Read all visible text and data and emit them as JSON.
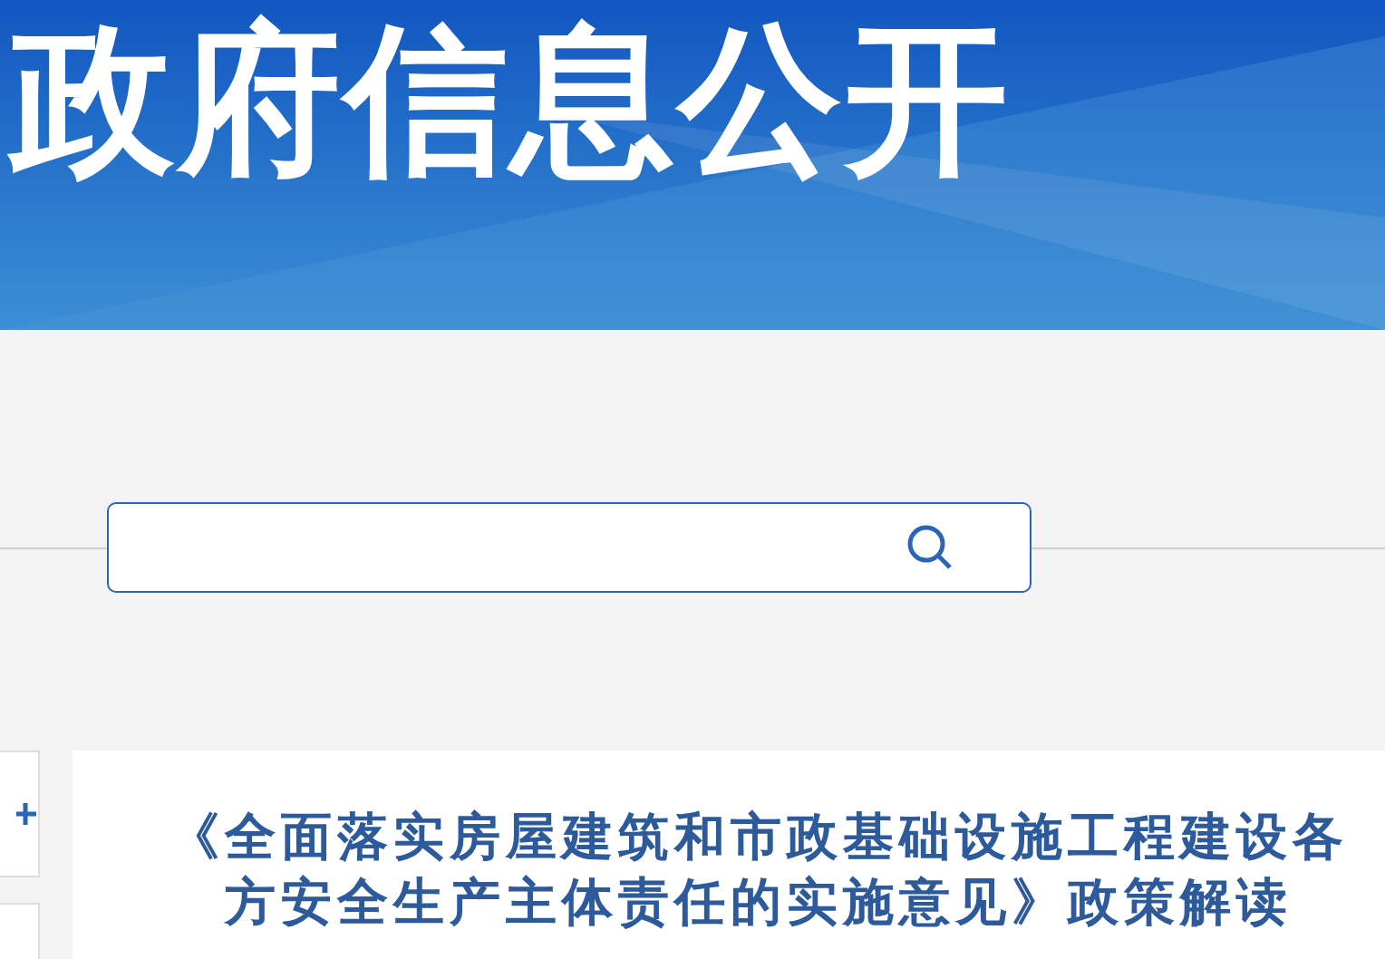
{
  "banner": {
    "title": "政府信息公开"
  },
  "side_panel": {
    "items": [
      {
        "kind": "expand"
      },
      {
        "kind": "empty"
      }
    ]
  },
  "article": {
    "title": "《全面落实房屋建筑和市政基础设施工程建设各方安全生产主体责任的实施意见》政策解读"
  }
}
